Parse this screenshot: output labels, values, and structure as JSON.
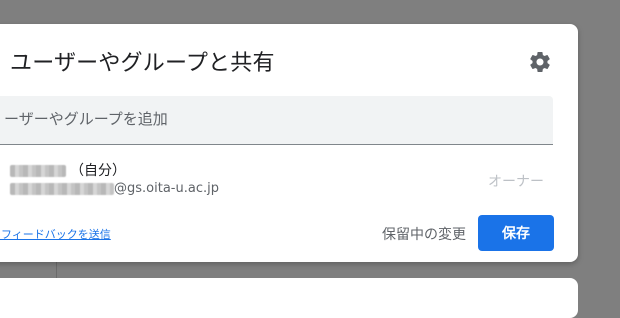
{
  "dialog": {
    "title": "ユーザーやグループと共有",
    "settings_icon": "gear-icon",
    "add_input": {
      "placeholder": "ーザーやグループを追加",
      "value": ""
    },
    "person": {
      "name_suffix": "（自分）",
      "email_domain": "@gs.oita-u.ac.jp",
      "role": "オーナー"
    },
    "feedback_link": "にフィードバックを送信",
    "pending_text": "保留中の変更",
    "save_label": "保存"
  },
  "colors": {
    "accent": "#1a73e8",
    "backdrop": "#7f7f7f",
    "input_bg": "#f1f3f4",
    "role_text": "#bdc1c6"
  }
}
